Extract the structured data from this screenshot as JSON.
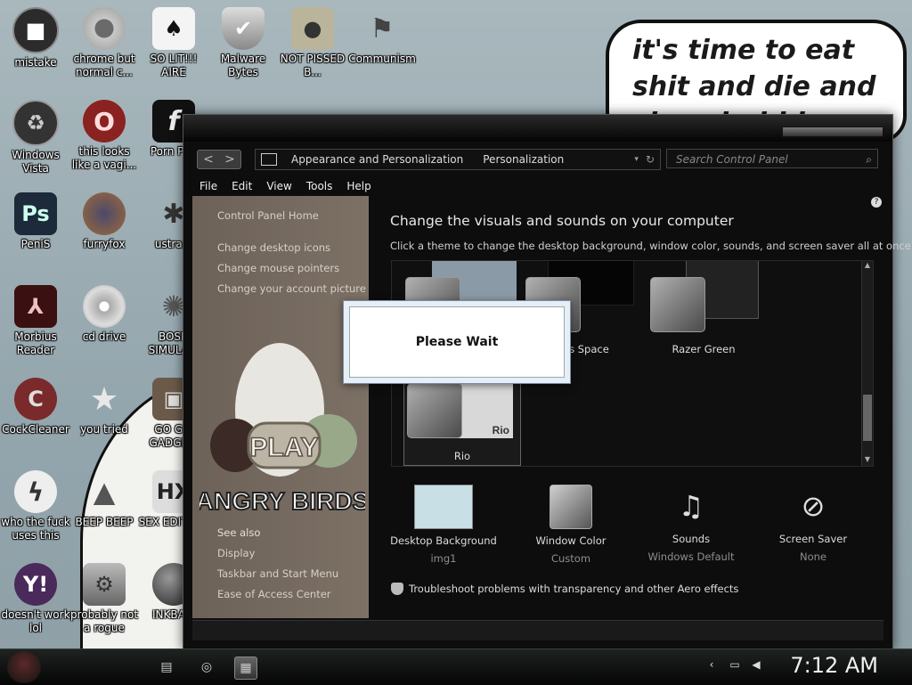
{
  "desktop": {
    "speech_text": "it's time to eat shit and die and chew bubble gum",
    "icons": [
      {
        "label": "mistake",
        "icon": "generic-app-icon"
      },
      {
        "label": "chrome but normal c...",
        "icon": "chrome-icon"
      },
      {
        "label": "SO LIT!!! AIRE",
        "icon": "cards-icon"
      },
      {
        "label": "Malware Bytes",
        "icon": "shield-icon"
      },
      {
        "label": "NOT PISSED B...",
        "icon": "pig-icon"
      },
      {
        "label": "Communism",
        "icon": "eagle-icon"
      },
      {
        "label": "Windows Vista",
        "icon": "recycle-bin-icon"
      },
      {
        "label": "this looks like a vagi...",
        "icon": "opera-icon"
      },
      {
        "label": "Porn Pl...",
        "icon": "flash-icon"
      },
      {
        "label": "PeniS",
        "icon": "photoshop-icon"
      },
      {
        "label": "furryfox",
        "icon": "firefox-icon"
      },
      {
        "label": "ustra...",
        "icon": "spider-icon"
      },
      {
        "label": "Morbius Reader",
        "icon": "acrobat-icon"
      },
      {
        "label": "cd drive",
        "icon": "cd-icon"
      },
      {
        "label": "BOSN SIMULA...",
        "icon": "gear-icon"
      },
      {
        "label": "CockCleaner",
        "icon": "ccleaner-icon"
      },
      {
        "label": "you tried",
        "icon": "star-icon"
      },
      {
        "label": "GO G... GADGE...",
        "icon": "briefcase-icon"
      },
      {
        "label": "who the fuck uses this",
        "icon": "lightning-icon"
      },
      {
        "label": "BEEP BEEP",
        "icon": "cone-icon"
      },
      {
        "label": "SEX EDITIO...",
        "icon": "hx-icon"
      },
      {
        "label": "doesn't work lol",
        "icon": "yahoo-icon"
      },
      {
        "label": "probably not a rogue",
        "icon": "settings-icon"
      },
      {
        "label": "INKBA...",
        "icon": "ball-icon"
      }
    ]
  },
  "window": {
    "nav_back": "<",
    "nav_forward": ">",
    "breadcrumb": [
      "Appearance and Personalization",
      "Personalization"
    ],
    "search_placeholder": "Search Control Panel",
    "menu": [
      "File",
      "Edit",
      "View",
      "Tools",
      "Help"
    ],
    "left_links": [
      "Control Panel Home",
      "Change desktop icons",
      "Change mouse pointers",
      "Change your account picture"
    ],
    "promo": {
      "play": "PLAY",
      "brand": "ANGRY BIRDS"
    },
    "see_also_title": "See also",
    "see_also": [
      "Display",
      "Taskbar and Start Menu",
      "Ease of Access Center"
    ],
    "heading": "Change the visuals and sounds on your computer",
    "subheading": "Click a theme to change the desktop background, window color, sounds, and screen saver all at once.",
    "themes": [
      {
        "label": ""
      },
      {
        "label": "Birds Space"
      },
      {
        "label": "Razer Green"
      },
      {
        "label": "Rio"
      }
    ],
    "thumb_caption": "Rio",
    "bottom_items": [
      {
        "title": "Desktop Background",
        "value": "img1",
        "icon": "desktop-background-icon"
      },
      {
        "title": "Window Color",
        "value": "Custom",
        "icon": "window-color-icon"
      },
      {
        "title": "Sounds",
        "value": "Windows Default",
        "icon": "sounds-icon"
      },
      {
        "title": "Screen Saver",
        "value": "None",
        "icon": "screen-saver-icon"
      }
    ],
    "troubleshoot": "Troubleshoot problems with transparency and other Aero effects"
  },
  "dialog": {
    "message": "Please Wait"
  },
  "taskbar": {
    "time": "7:12 AM"
  }
}
